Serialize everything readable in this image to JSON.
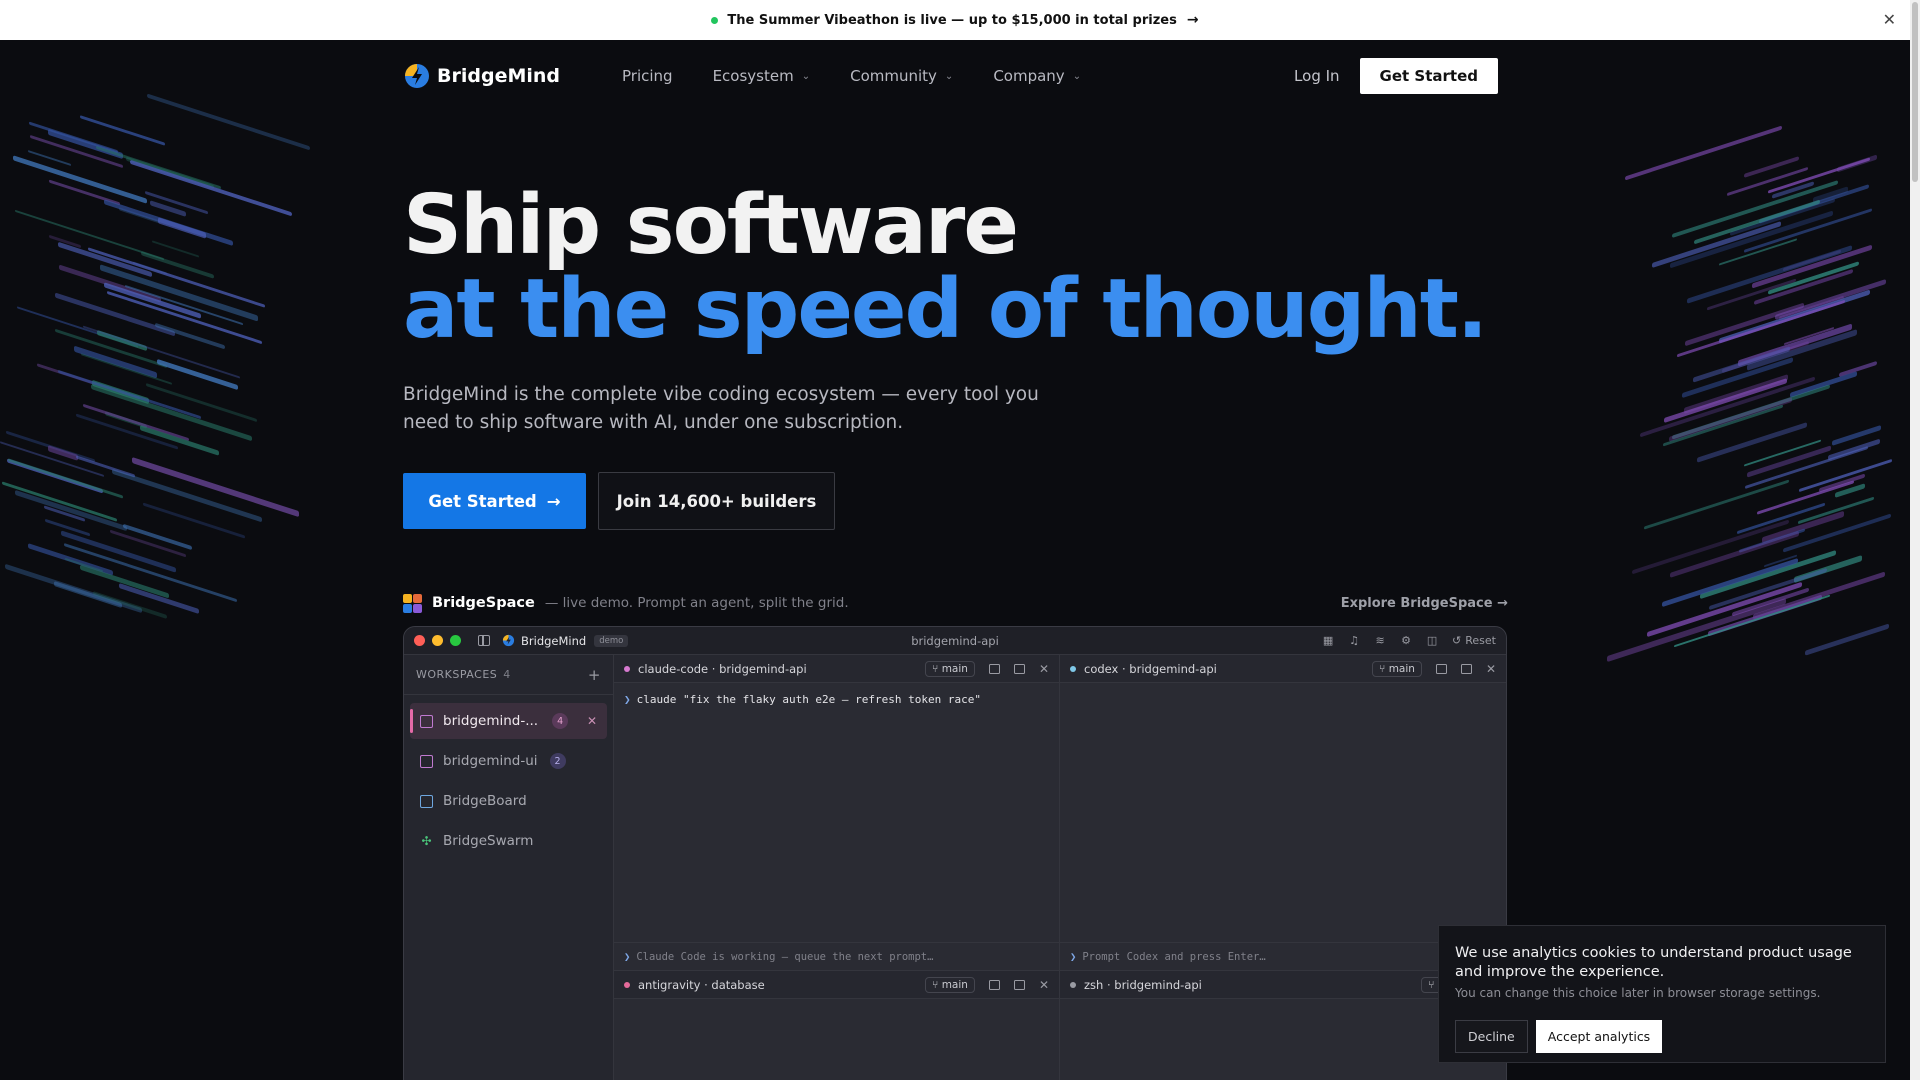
{
  "announcement": {
    "text": "The Summer Vibeathon is live — up to $15,000 in total prizes",
    "arrow": "→",
    "close": "✕"
  },
  "nav": {
    "brand": "BridgeMind",
    "links": [
      {
        "label": "Pricing"
      },
      {
        "label": "Ecosystem"
      },
      {
        "label": "Community"
      },
      {
        "label": "Company"
      }
    ],
    "login": "Log In",
    "cta": "Get Started"
  },
  "hero": {
    "line1": "Ship software",
    "line2": "at the speed of thought.",
    "subtitle": "BridgeMind is the complete vibe coding ecosystem — every tool you need to ship software with AI, under one subscription.",
    "primary_cta": "Get Started",
    "secondary_cta": "Join 14,600+ builders"
  },
  "bridgespace": {
    "title": "BridgeSpace",
    "tagline": "— live demo. Prompt an agent, split the grid.",
    "explore": "Explore BridgeSpace →"
  },
  "app": {
    "brand": "BridgeMind",
    "badge": "demo",
    "window_title": "bridgemind-api",
    "reset": "Reset",
    "workspaces_label": "WORKSPACES",
    "workspaces_count": "4",
    "workspaces": [
      {
        "name": "bridgemind-...",
        "badge": "4"
      },
      {
        "name": "bridgemind-ui",
        "badge": "2"
      },
      {
        "name": "BridgeBoard"
      },
      {
        "name": "BridgeSwarm"
      }
    ],
    "panes": [
      {
        "title": "claude-code · bridgemind-api",
        "branch": "main",
        "dot": "#d77ad0",
        "command": "claude \"fix the flaky auth e2e — refresh token race\"",
        "footer": "Claude Code is working — queue the next prompt…"
      },
      {
        "title": "codex · bridgemind-api",
        "branch": "main",
        "dot": "#7fc8e8",
        "command": "",
        "footer": "Prompt Codex and press Enter…"
      },
      {
        "title": "antigravity · database",
        "branch": "main",
        "dot": "#e56a9a"
      },
      {
        "title": "zsh · bridgemind-api",
        "branch": "main",
        "dot": "#9a9ba3"
      }
    ]
  },
  "cookie": {
    "message": "We use analytics cookies to understand product usage and improve the experience.",
    "note": "You can change this choice later in browser storage settings.",
    "decline": "Decline",
    "accept": "Accept analytics"
  },
  "colors": {
    "accent_blue": "#3b8ef0",
    "cta_blue": "#1477e6",
    "background": "#0b0c10"
  }
}
